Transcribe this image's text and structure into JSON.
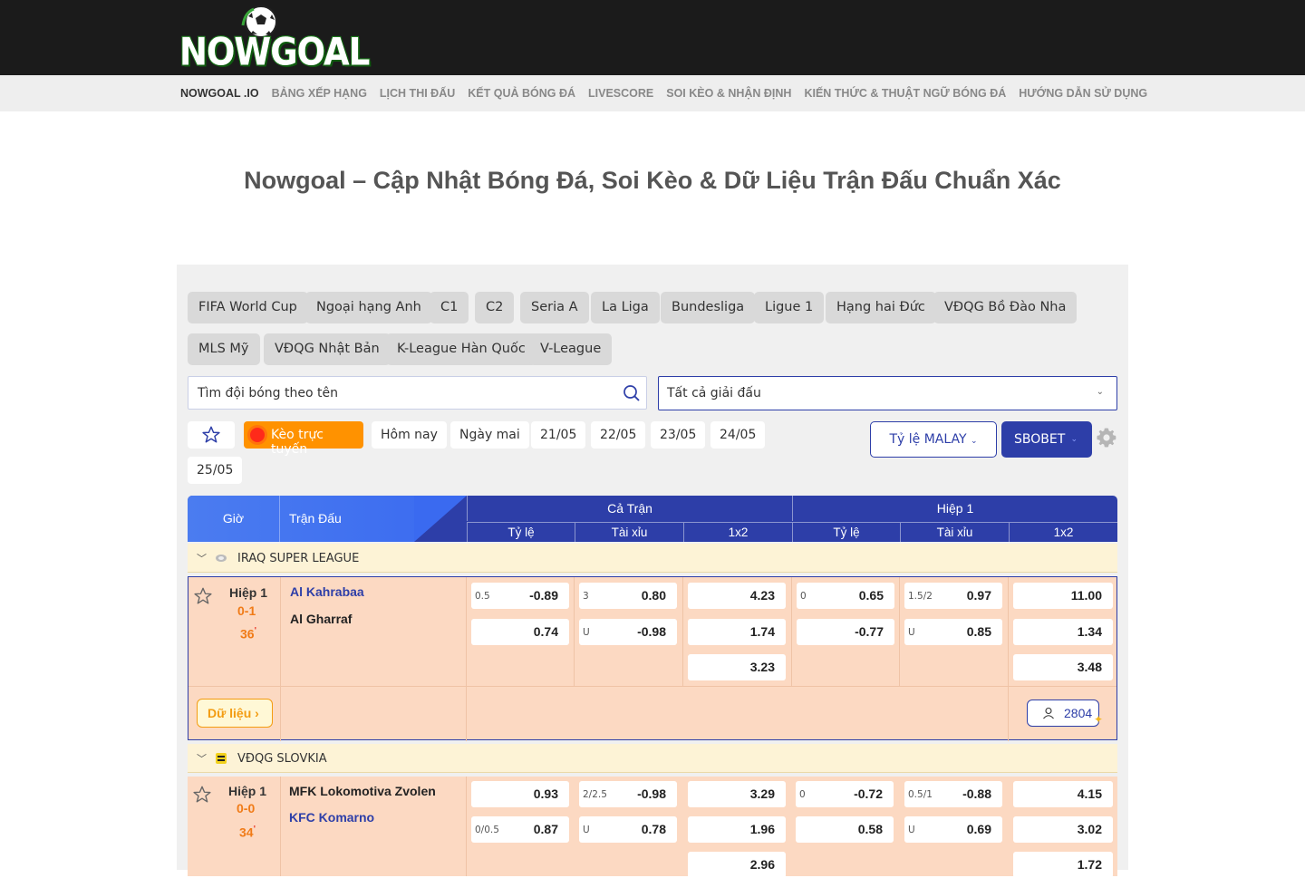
{
  "brand": {
    "logo_text": "NOWGOAL"
  },
  "nav": {
    "items": [
      "NOWGOAL .IO",
      "BẢNG XẾP HẠNG",
      "LỊCH THI ĐẤU",
      "KẾT QUẢ BÓNG ĐÁ",
      "LIVESCORE",
      "SOI KÈO & NHẬN ĐỊNH",
      "KIẾN THỨC & THUẬT NGỮ BÓNG ĐÁ",
      "HƯỚNG DẪN SỬ DỤNG"
    ]
  },
  "page_title": "Nowgoal – Cập Nhật Bóng Đá, Soi Kèo & Dữ Liệu Trận Đấu Chuẩn Xác",
  "league_chips": [
    "FIFA World Cup",
    "Ngoại hạng Anh",
    "C1",
    "C2",
    "Seria A",
    "La Liga",
    "Bundesliga",
    "Ligue 1",
    "Hạng hai Đức",
    "VĐQG Bồ Đào Nha",
    "MLS Mỹ",
    "VĐQG Nhật Bản",
    "K-League Hàn Quốc",
    "V-League"
  ],
  "search": {
    "placeholder": "Tìm đội bóng theo tên"
  },
  "league_filter": {
    "selected": "Tất cả giải đấu"
  },
  "day_filter": {
    "live_label": "Kèo trực tuyến",
    "days": [
      "Hôm nay",
      "Ngày mai",
      "21/05",
      "22/05",
      "23/05",
      "24/05",
      "25/05"
    ]
  },
  "odds_format": {
    "label": "Tỷ lệ MALAY"
  },
  "bookmaker": {
    "label": "SBOBET"
  },
  "table": {
    "col_time": "Giờ",
    "col_match": "Trận Đấu",
    "group_full": "Cả Trận",
    "group_half": "Hiệp 1",
    "sub_cols": [
      "Tỷ lệ",
      "Tài xỉu",
      "1x2",
      "Tỷ lệ",
      "Tài xỉu",
      "1x2"
    ]
  },
  "leagues": [
    {
      "name": "IRAQ SUPER LEAGUE",
      "match": {
        "status": "Hiệp 1",
        "score": "0-1",
        "minute": "36",
        "home": "Al Kahrabaa",
        "away": "Al Gharraf",
        "ft_hdp": [
          {
            "line": "0.5",
            "odds": "-0.89"
          },
          {
            "line": "",
            "odds": "0.74"
          }
        ],
        "ft_ou": [
          {
            "line": "3",
            "odds": "0.80"
          },
          {
            "line": "U",
            "odds": "-0.98"
          }
        ],
        "ft_1x2": [
          "4.23",
          "1.74",
          "3.23"
        ],
        "h1_hdp": [
          {
            "line": "0",
            "odds": "0.65"
          },
          {
            "line": "",
            "odds": "-0.77"
          }
        ],
        "h1_ou": [
          {
            "line": "1.5/2",
            "odds": "0.97"
          },
          {
            "line": "U",
            "odds": "0.85"
          }
        ],
        "h1_1x2": [
          "11.00",
          "1.34",
          "3.48"
        ],
        "data_label": "Dữ liệu",
        "viewers": "2804"
      }
    },
    {
      "name": "VĐQG SLOVKIA",
      "match": {
        "status": "Hiệp 1",
        "score": "0-0",
        "minute": "34",
        "home": "MFK Lokomotiva Zvolen",
        "away": "KFC Komarno",
        "ft_hdp": [
          {
            "line": "",
            "odds": "0.93"
          },
          {
            "line": "0/0.5",
            "odds": "0.87"
          }
        ],
        "ft_ou": [
          {
            "line": "2/2.5",
            "odds": "-0.98"
          },
          {
            "line": "U",
            "odds": "0.78"
          }
        ],
        "ft_1x2": [
          "3.29",
          "1.96",
          "2.96"
        ],
        "h1_hdp": [
          {
            "line": "0",
            "odds": "-0.72"
          },
          {
            "line": "",
            "odds": "0.58"
          }
        ],
        "h1_ou": [
          {
            "line": "0.5/1",
            "odds": "-0.88"
          },
          {
            "line": "U",
            "odds": "0.69"
          }
        ],
        "h1_1x2": [
          "4.15",
          "3.02",
          "1.72"
        ]
      }
    }
  ],
  "colors": {
    "primary": "#2d3ea8",
    "accent": "#ff9200",
    "row_bg": "#fcd9c2",
    "league_bg": "#fdf3d6"
  }
}
